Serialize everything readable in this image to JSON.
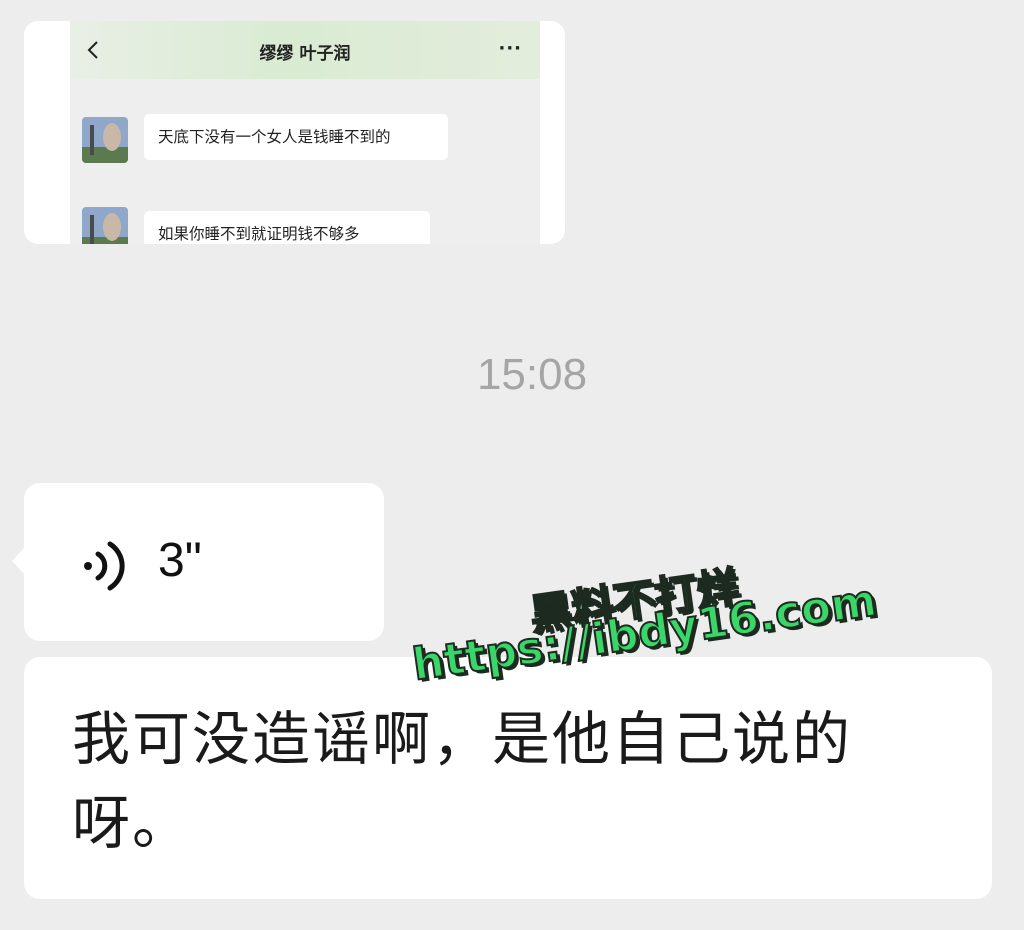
{
  "forwarded_screenshot": {
    "header_title": "缪缪 叶子润",
    "back_icon": "chevron-left-icon",
    "more_icon": "ellipsis-icon",
    "messages": [
      {
        "text": "天底下没有一个女人是钱睡不到的"
      },
      {
        "text": "如果你睡不到就证明钱不够多"
      }
    ]
  },
  "timestamp": "15:08",
  "voice_message": {
    "icon": "voice-wave-icon",
    "duration": "3\""
  },
  "text_message": {
    "text": "我可没造谣啊，是他自己说的呀。"
  },
  "watermark": {
    "line1": "黑料不打烊",
    "line2": "https://ibdy16.com",
    "color": "#3bd66a"
  }
}
